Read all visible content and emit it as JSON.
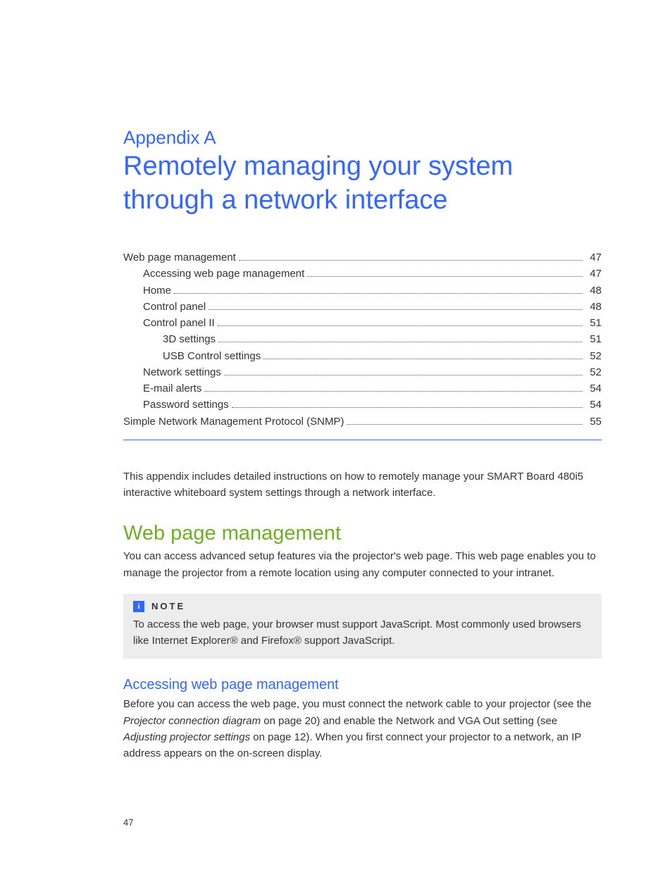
{
  "appendix": {
    "label": "Appendix  A",
    "title": "Remotely managing your system through a network interface"
  },
  "toc": [
    {
      "label": "Web page management",
      "page": "47",
      "indent": 0
    },
    {
      "label": "Accessing web page management",
      "page": "47",
      "indent": 1
    },
    {
      "label": "Home",
      "page": "48",
      "indent": 1
    },
    {
      "label": "Control panel",
      "page": "48",
      "indent": 1
    },
    {
      "label": "Control panel II",
      "page": "51",
      "indent": 1
    },
    {
      "label": "3D settings",
      "page": "51",
      "indent": 2
    },
    {
      "label": "USB Control settings",
      "page": "52",
      "indent": 2
    },
    {
      "label": "Network settings",
      "page": "52",
      "indent": 1
    },
    {
      "label": "E-mail alerts",
      "page": "54",
      "indent": 1
    },
    {
      "label": "Password settings",
      "page": "54",
      "indent": 1
    },
    {
      "label": "Simple Network Management Protocol (SNMP)",
      "page": "55",
      "indent": 0
    }
  ],
  "intro": "This appendix includes detailed instructions on how to remotely manage your SMART Board 480i5 interactive whiteboard system settings through a network interface.",
  "section1": {
    "heading": "Web page management",
    "body": "You can access advanced setup features via the projector's web page. This web page enables you to manage the projector from a remote location using any computer connected to your intranet."
  },
  "note": {
    "label": "NOTE",
    "body": "To access the web page, your browser must support JavaScript. Most commonly used browsers like Internet Explorer® and Firefox® support JavaScript."
  },
  "subsection": {
    "heading": "Accessing web page management",
    "body_parts": {
      "a": "Before you can access the web page, you must connect the network cable to your projector (see the ",
      "i1": "Projector connection diagram",
      "b": " on page 20) and enable the Network and VGA Out setting (see ",
      "i2": "Adjusting projector settings",
      "c": " on page 12). When you first connect your projector to a network, an IP address appears on the on-screen display."
    }
  },
  "pageNumber": "47"
}
